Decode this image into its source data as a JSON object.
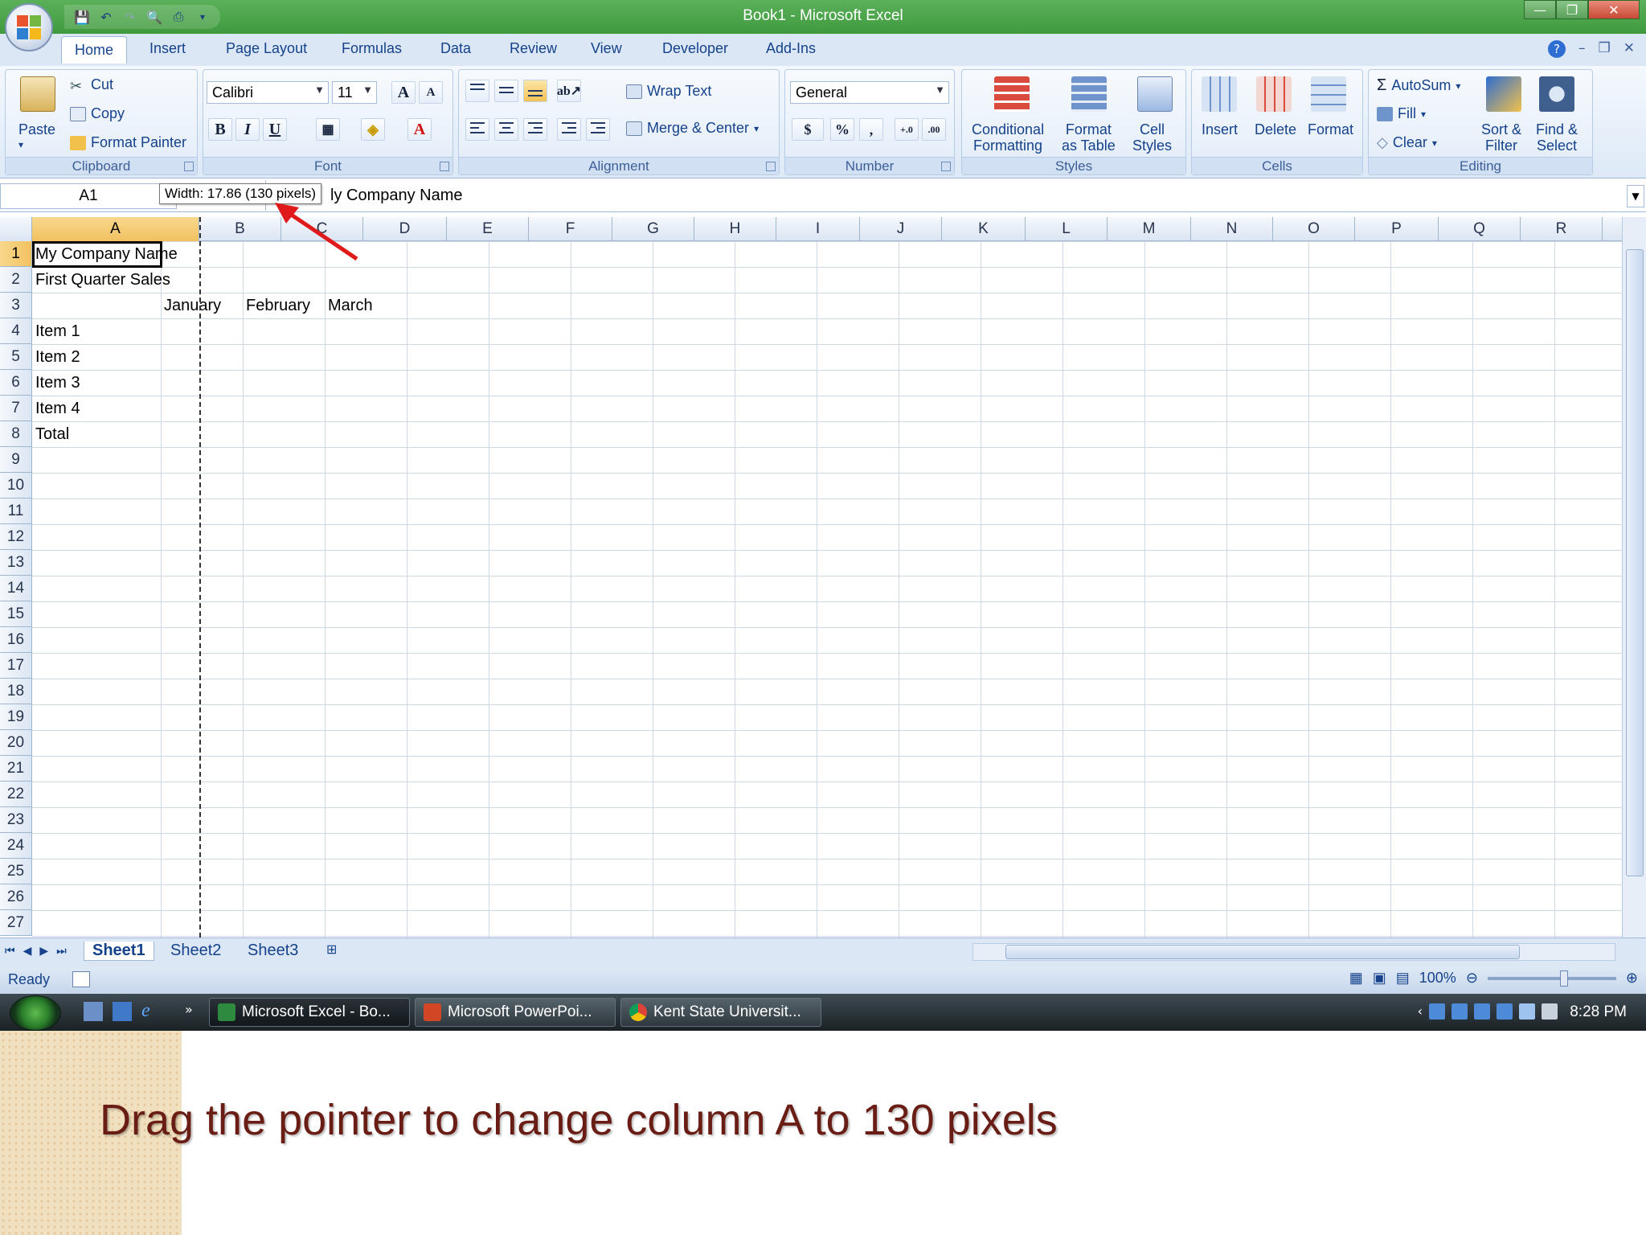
{
  "window": {
    "title": "Book1 - Microsoft Excel",
    "minimize": "—",
    "restore": "❐",
    "close": "✕"
  },
  "qat": {
    "save_icon": "save-icon",
    "undo_icon": "undo-icon",
    "redo_icon": "redo-icon",
    "preview_icon": "print-preview-icon",
    "print_icon": "print-icon"
  },
  "tabs": [
    "Home",
    "Insert",
    "Page Layout",
    "Formulas",
    "Data",
    "Review",
    "View",
    "Developer",
    "Add-Ins"
  ],
  "ribbon": {
    "clipboard": {
      "label": "Clipboard",
      "paste": "Paste",
      "cut": "Cut",
      "copy": "Copy",
      "format_painter": "Format Painter"
    },
    "font": {
      "label": "Font",
      "name": "Calibri",
      "size": "11",
      "grow": "A",
      "shrink": "A",
      "bold": "B",
      "italic": "I",
      "underline": "U",
      "font_color": "A"
    },
    "alignment": {
      "label": "Alignment",
      "wrap_text": "Wrap Text",
      "merge_center": "Merge & Center"
    },
    "number": {
      "label": "Number",
      "format": "General",
      "currency": "$",
      "percent": "%",
      "comma": ",",
      "inc_decimal": "+.0",
      "dec_decimal": ".00"
    },
    "styles": {
      "label": "Styles",
      "conditional": [
        "Conditional",
        "Formatting"
      ],
      "format_table": [
        "Format",
        "as Table"
      ],
      "cell_styles": [
        "Cell",
        "Styles"
      ]
    },
    "cells": {
      "label": "Cells",
      "insert": "Insert",
      "delete": "Delete",
      "format": "Format"
    },
    "editing": {
      "label": "Editing",
      "autosum": "AutoSum",
      "fill": "Fill",
      "clear": "Clear",
      "sort_filter": [
        "Sort &",
        "Filter"
      ],
      "find_select": [
        "Find &",
        "Select"
      ]
    }
  },
  "formula_bar": {
    "name_box": "A1",
    "formula_visible": "ly Company Name",
    "tooltip": "Width: 17.86 (130 pixels)"
  },
  "columns": [
    "A",
    "B",
    "C",
    "D",
    "E",
    "F",
    "G",
    "H",
    "I",
    "J",
    "K",
    "L",
    "M",
    "N",
    "O",
    "P",
    "Q",
    "R"
  ],
  "rows": [
    "1",
    "2",
    "3",
    "4",
    "5",
    "6",
    "7",
    "8",
    "9",
    "10",
    "11",
    "12",
    "13",
    "14",
    "15",
    "16",
    "17",
    "18",
    "19",
    "20",
    "21",
    "22",
    "23",
    "24",
    "25",
    "26",
    "27"
  ],
  "cells": {
    "A1": "My Company Name",
    "A2": "First Quarter Sales",
    "B3": "January",
    "C3": "February",
    "D3": "March",
    "A4": "Item 1",
    "A5": "Item 2",
    "A6": "Item 3",
    "A7": "Item 4",
    "A8": "Total"
  },
  "sheets": [
    "Sheet1",
    "Sheet2",
    "Sheet3"
  ],
  "status": {
    "state": "Ready",
    "zoom": "100%"
  },
  "taskbar": {
    "buttons": [
      "Microsoft Excel - Bo...",
      "Microsoft PowerPoi...",
      "Kent State Universit..."
    ],
    "clock": "8:28 PM"
  },
  "caption": "Drag the pointer to change column A to 130 pixels"
}
